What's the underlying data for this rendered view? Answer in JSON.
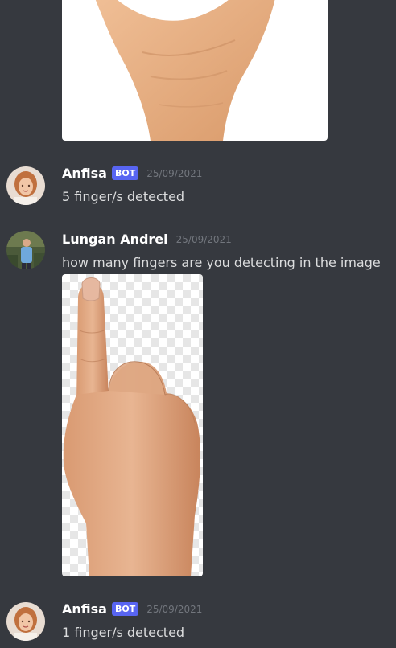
{
  "messages": [
    {
      "username": "Anfisa",
      "badge": "BOT",
      "timestamp": "25/09/2021",
      "content": "5 finger/s detected"
    },
    {
      "username": "Lungan Andrei",
      "timestamp": "25/09/2021",
      "content": "how many fingers are you detecting in the image"
    },
    {
      "username": "Anfisa",
      "badge": "BOT",
      "timestamp": "25/09/2021",
      "content": "1 finger/s detected"
    }
  ],
  "colors": {
    "background": "#36393f",
    "username": "#ffffff",
    "text": "#dcddde",
    "timestamp": "#72767d",
    "bot_badge": "#5865f2"
  }
}
